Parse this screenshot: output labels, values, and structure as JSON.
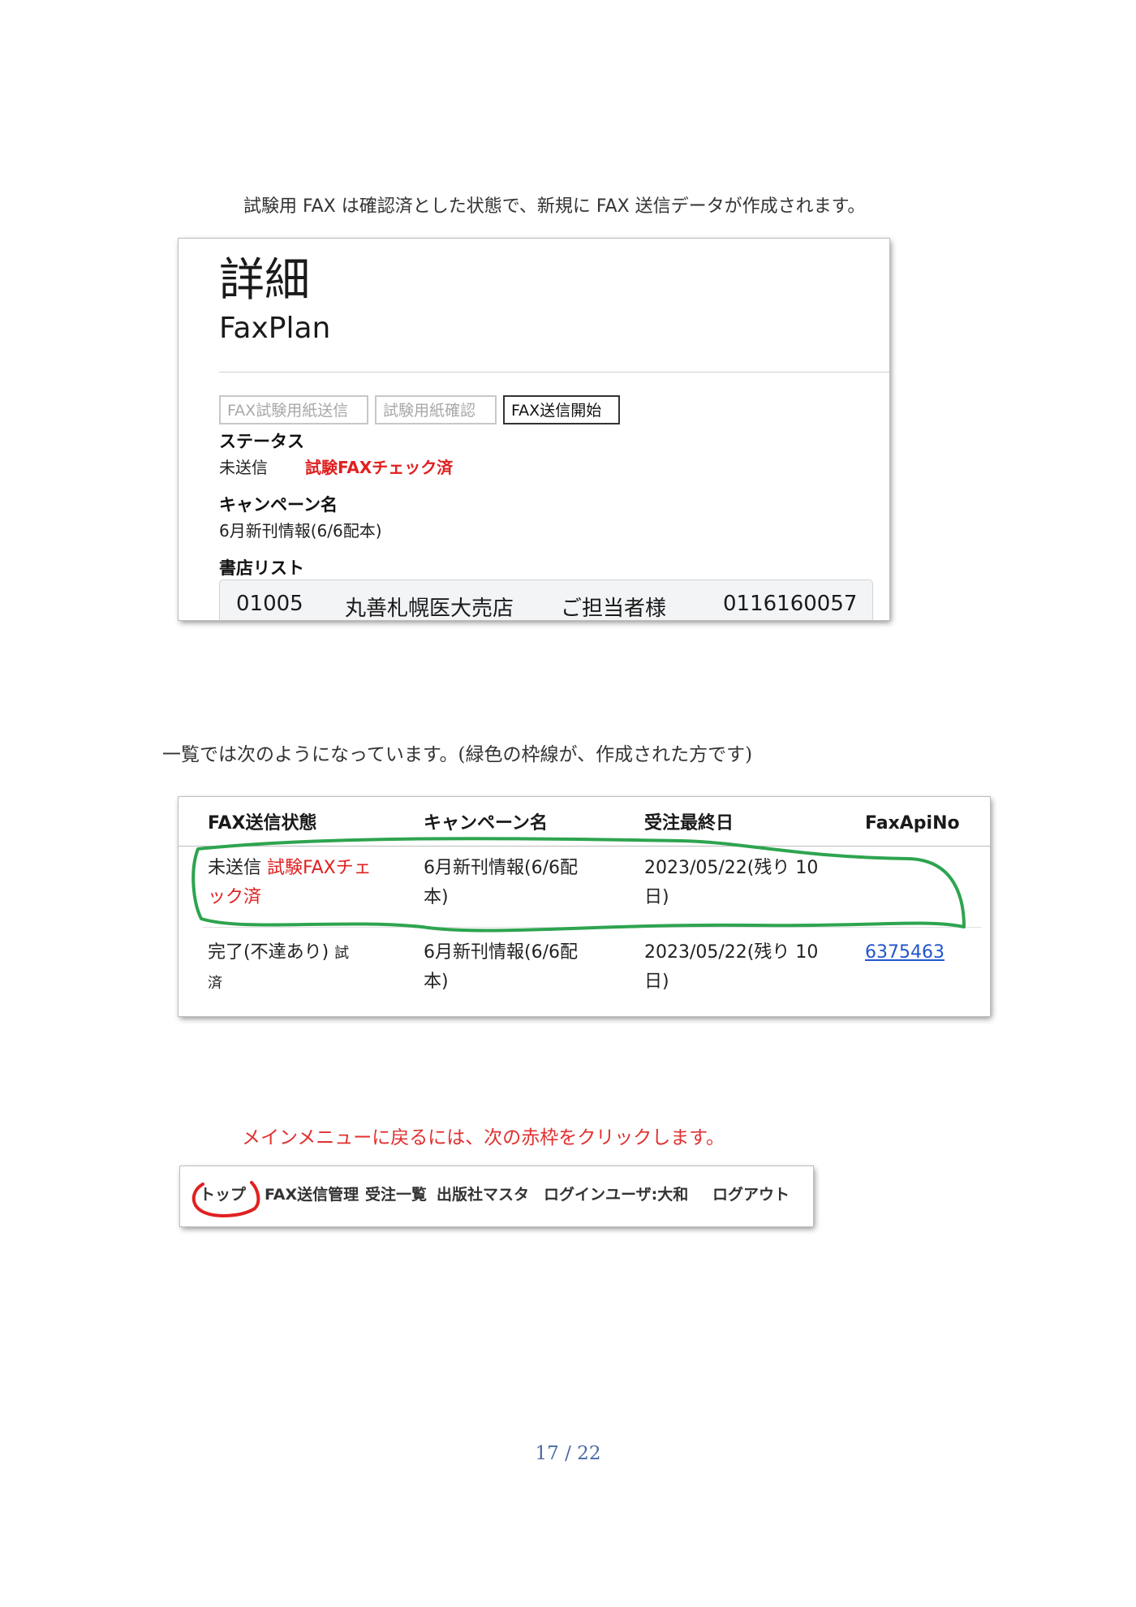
{
  "paragraphs": {
    "p1": "試験用 FAX は確認済とした状態で、新規に FAX 送信データが作成されます。",
    "p2": "一覧では次のようになっています。(緑色の枠線が、作成された方です)",
    "p3": "メインメニューに戻るには、次の赤枠をクリックします。"
  },
  "detail": {
    "title": "詳細",
    "subtitle": "FaxPlan",
    "buttons": [
      "FAX試験用紙送信",
      "試験用紙確認",
      "FAX送信開始"
    ],
    "status_label": "ステータス",
    "status_value": "未送信",
    "status_flag": "試験FAXチェック済",
    "campaign_label": "キャンペーン名",
    "campaign_value": "6月新刊情報(6/6配本)",
    "store_list_label": "書店リスト",
    "store_row": {
      "code": "01005",
      "name": "丸善札幌医大売店",
      "contact": "ご担当者様",
      "fax": "0116160057"
    }
  },
  "list": {
    "headers": [
      "FAX送信状態",
      "キャンペーン名",
      "受注最終日",
      "FaxApiNo"
    ],
    "rows": [
      {
        "status_line1_a": "未送信 ",
        "status_line1_b": "試験FAXチェ",
        "status_line2": "ック済",
        "campaign_line1": "6月新刊情報(6/6配",
        "campaign_line2": "本)",
        "date_line1": "2023/05/22(残り 10",
        "date_line2": "日)",
        "api_no": ""
      },
      {
        "status_line1_a": "完了(不達あり) ",
        "status_line1_b": "試",
        "status_line2": "済",
        "campaign_line1": "6月新刊情報(6/6配",
        "campaign_line2": "本)",
        "date_line1": "2023/05/22(残り 10",
        "date_line2": "日)",
        "api_no": "6375463"
      }
    ],
    "highlight_color": "#2ea44f"
  },
  "navbar": {
    "items": [
      "トップ",
      "FAX送信管理",
      "受注一覧",
      "出版社マスタ",
      "ログインユーザ:大和",
      "ログアウト"
    ],
    "highlight_color": "#e02020"
  },
  "page_number": "17 / 22"
}
